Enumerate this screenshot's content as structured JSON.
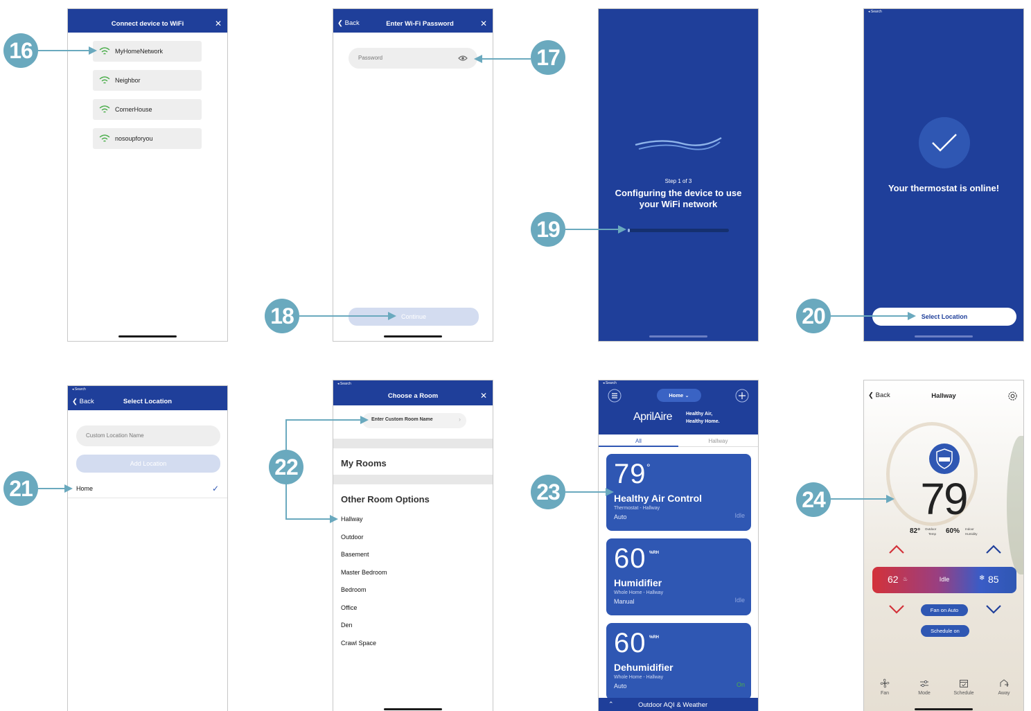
{
  "steps": {
    "s16": "16",
    "s17": "17",
    "s18": "18",
    "s19": "19",
    "s20": "20",
    "s21": "21",
    "s22": "22",
    "s23": "23",
    "s24": "24"
  },
  "screen1": {
    "title": "Connect device to WiFi",
    "close": "✕",
    "networks": [
      "MyHomeNetwork",
      "Neighbor",
      "CornerHouse",
      "nosoupforyou"
    ]
  },
  "screen2": {
    "back": "Back",
    "title": "Enter Wi-Fi Password",
    "close": "✕",
    "password_placeholder": "Password",
    "continue": "Continue"
  },
  "screen3": {
    "step": "Step 1 of 3",
    "message_line1": "Configuring the device to use",
    "message_line2": "your WiFi network",
    "progress": 0.02
  },
  "screen4": {
    "search": "◂ Search",
    "message": "Your thermostat is online!",
    "button": "Select Location"
  },
  "screen5": {
    "search": "◂ Search",
    "back": "Back",
    "title": "Select Location",
    "custom_placeholder": "Custom Location Name",
    "add_button": "Add Location",
    "location": "Home",
    "check": "✓"
  },
  "screen6": {
    "search": "◂ Search",
    "title": "Choose a Room",
    "close": "✕",
    "custom_room": "Enter Custom Room Name",
    "my_rooms": "My Rooms",
    "other_options": "Other Room Options",
    "rooms": [
      "Hallway",
      "Outdoor",
      "Basement",
      "Master Bedroom",
      "Bedroom",
      "Office",
      "Den",
      "Crawl Space"
    ]
  },
  "screen7": {
    "search": "◂ Search",
    "location": "Home",
    "brand": "AprilAire",
    "tagline1": "Healthy Air,",
    "tagline2": "Healthy Home.",
    "tabs": [
      "All",
      "Hallway"
    ],
    "cards": [
      {
        "value": "79",
        "unit": "°",
        "name": "Healthy Air Control",
        "sub": "Thermostat - Hallway",
        "mode": "Auto",
        "state": "Idle"
      },
      {
        "value": "60",
        "unit": "%RH",
        "name": "Humidifier",
        "sub": "Whole Home - Hallway",
        "mode": "Manual",
        "state": "Idle"
      },
      {
        "value": "60",
        "unit": "%RH",
        "name": "Dehumidifier",
        "sub": "Whole Home - Hallway",
        "mode": "Auto",
        "state": "On"
      }
    ],
    "footer": "Outdoor AQI & Weather"
  },
  "screen8": {
    "back": "Back",
    "title": "Hallway",
    "temp": "79",
    "outdoor_temp": "82°",
    "outdoor_label1": "Outdoor",
    "outdoor_label2": "Temp",
    "humidity": "60%",
    "humidity_label1": "Indoor",
    "humidity_label2": "Humidity",
    "heat_setpoint": "62",
    "status": "Idle",
    "cool_setpoint": "85",
    "fan_pill": "Fan on Auto",
    "schedule_pill": "Schedule on",
    "nav": [
      "Fan",
      "Mode",
      "Schedule",
      "Away"
    ]
  },
  "colors": {
    "brand_blue": "#1f3f9a",
    "card_blue": "#2f57b3",
    "callout_teal": "#6aa9be",
    "heat_red": "#d3323a"
  }
}
